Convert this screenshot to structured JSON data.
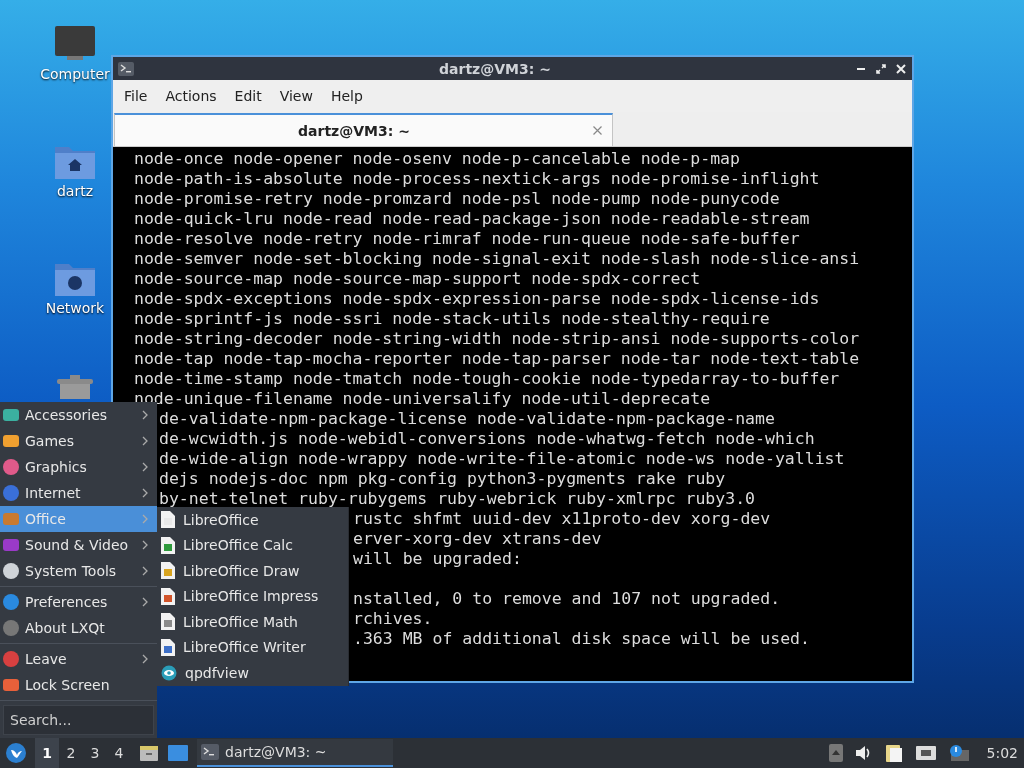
{
  "desktop_icons": [
    {
      "kind": "computer",
      "label": "Computer"
    },
    {
      "kind": "home",
      "label": "dartz"
    },
    {
      "kind": "network",
      "label": "Network"
    },
    {
      "kind": "trash"
    }
  ],
  "window": {
    "title": "dartz@VM3: ~",
    "menu": [
      "File",
      "Actions",
      "Edit",
      "View",
      "Help"
    ],
    "tabs": [
      {
        "label": "dartz@VM3: ~",
        "selected": true
      }
    ],
    "terminal": {
      "blocks": [
        [
          "node-once node-opener node-osenv node-p-cancelable node-p-map",
          "node-path-is-absolute node-process-nextick-args node-promise-inflight",
          "node-promise-retry node-promzard node-psl node-pump node-punycode",
          "node-quick-lru node-read node-read-package-json node-readable-stream",
          "node-resolve node-retry node-rimraf node-run-queue node-safe-buffer",
          "node-semver node-set-blocking node-signal-exit node-slash node-slice-ansi",
          "node-source-map node-source-map-support node-spdx-correct",
          "node-spdx-exceptions node-spdx-expression-parse node-spdx-license-ids",
          "node-sprintf-js node-ssri node-stack-utils node-stealthy-require",
          "node-string-decoder node-string-width node-strip-ansi node-supports-color",
          "node-tap node-tap-mocha-reporter node-tap-parser node-tar node-text-table",
          "node-time-stamp node-tmatch node-tough-cookie node-typedarray-to-buffer",
          "node-unique-filename node-universalify node-util-deprecate"
        ],
        [
          "de-validate-npm-package-license node-validate-npm-package-name",
          "de-wcwidth.js node-webidl-conversions node-whatwg-fetch node-which",
          "de-wide-align node-wrappy node-write-file-atomic node-ws node-yallist",
          "dejs nodejs-doc npm pkg-config python3-pygments rake ruby",
          "by-net-telnet ruby-rubygems ruby-webrick ruby-xmlrpc ruby3.0"
        ],
        [
          "rustc shfmt uuid-dev x11proto-dev xorg-dev",
          "erver-xorg-dev xtrans-dev",
          "will be upgraded:"
        ],
        [
          "nstalled, 0 to remove and 107 not upgraded.",
          "rchives.",
          ".363 MB of additional disk space will be used."
        ]
      ]
    }
  },
  "app_menu": {
    "sections": [
      [
        {
          "kind": "accessories",
          "label": "Accessories",
          "submenu": true,
          "selected": false
        },
        {
          "kind": "games",
          "label": "Games",
          "submenu": true,
          "selected": false
        },
        {
          "kind": "graphics",
          "label": "Graphics",
          "submenu": true,
          "selected": false
        },
        {
          "kind": "internet",
          "label": "Internet",
          "submenu": true,
          "selected": false
        },
        {
          "kind": "office",
          "label": "Office",
          "submenu": true,
          "selected": true
        },
        {
          "kind": "sound",
          "label": "Sound & Video",
          "submenu": true,
          "selected": false
        },
        {
          "kind": "system",
          "label": "System Tools",
          "submenu": true,
          "selected": false
        }
      ],
      [
        {
          "kind": "preferences",
          "label": "Preferences",
          "submenu": true,
          "selected": false
        },
        {
          "kind": "about",
          "label": "About LXQt",
          "submenu": false,
          "selected": false
        }
      ],
      [
        {
          "kind": "leave",
          "label": "Leave",
          "submenu": true,
          "selected": false
        },
        {
          "kind": "lock",
          "label": "Lock Screen",
          "submenu": false,
          "selected": false
        }
      ]
    ],
    "search": {
      "placeholder": "Search..."
    }
  },
  "submenu": [
    {
      "kind": "doc",
      "label": "LibreOffice"
    },
    {
      "kind": "calc",
      "label": "LibreOffice Calc"
    },
    {
      "kind": "draw",
      "label": "LibreOffice Draw"
    },
    {
      "kind": "impress",
      "label": "LibreOffice Impress"
    },
    {
      "kind": "math",
      "label": "LibreOffice Math"
    },
    {
      "kind": "writer",
      "label": "LibreOffice Writer"
    },
    {
      "kind": "viewer",
      "label": "qpdfview"
    }
  ],
  "taskbar": {
    "desktops": [
      {
        "label": "1",
        "selected": true
      },
      {
        "label": "2",
        "selected": false
      },
      {
        "label": "3",
        "selected": false
      },
      {
        "label": "4",
        "selected": false
      }
    ],
    "tasks": [
      {
        "label": "dartz@VM3: ~",
        "selected": true
      }
    ],
    "clock": "5:02"
  }
}
